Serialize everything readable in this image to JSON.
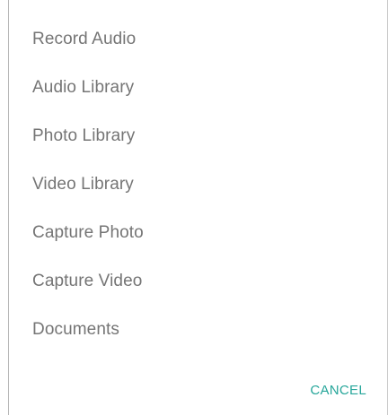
{
  "dialog": {
    "options": [
      {
        "label": "Record Audio"
      },
      {
        "label": "Audio Library"
      },
      {
        "label": "Photo Library"
      },
      {
        "label": "Video Library"
      },
      {
        "label": "Capture Photo"
      },
      {
        "label": "Capture Video"
      },
      {
        "label": "Documents"
      }
    ],
    "cancel_label": "CANCEL"
  },
  "colors": {
    "option_text": "#757575",
    "accent": "#26a69a",
    "background": "#ffffff"
  }
}
